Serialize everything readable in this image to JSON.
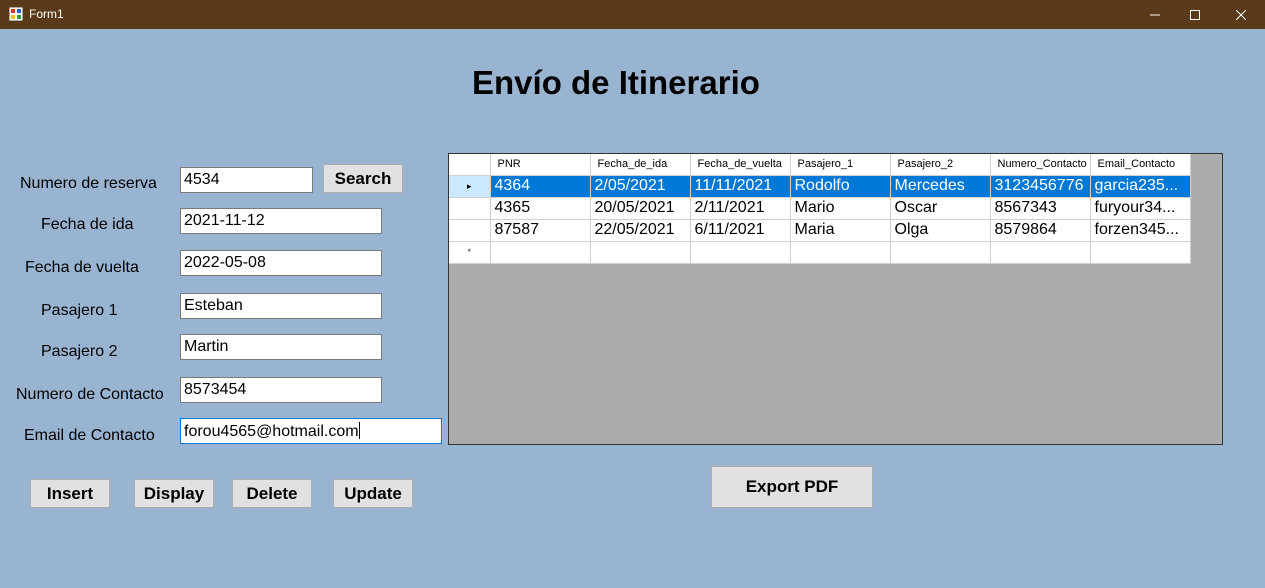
{
  "window": {
    "title": "Form1"
  },
  "heading": "Envío de Itinerario",
  "form": {
    "reserva_label": "Numero de reserva",
    "reserva_value": "4534",
    "fecha_ida_label": "Fecha de ida",
    "fecha_ida_value": "2021-11-12",
    "fecha_vuelta_label": "Fecha de vuelta",
    "fecha_vuelta_value": "2022-05-08",
    "pasajero1_label": "Pasajero 1",
    "pasajero1_value": "Esteban",
    "pasajero2_label": "Pasajero 2",
    "pasajero2_value": "Martin",
    "contacto_label": "Numero de Contacto",
    "contacto_value": "8573454",
    "email_label": "Email de Contacto",
    "email_value": "forou4565@hotmail.com"
  },
  "buttons": {
    "search": "Search",
    "insert": "Insert",
    "display": "Display",
    "delete": "Delete",
    "update": "Update",
    "export_pdf": "Export PDF"
  },
  "grid": {
    "columns": [
      "PNR",
      "Fecha_de_ida",
      "Fecha_de_vuelta",
      "Pasajero_1",
      "Pasajero_2",
      "Numero_Contacto",
      "Email_Contacto"
    ],
    "rows": [
      [
        "4364",
        "2/05/2021",
        "11/11/2021",
        "Rodolfo",
        "Mercedes",
        "3123456776",
        "garcia235..."
      ],
      [
        "4365",
        "20/05/2021",
        "2/11/2021",
        "Mario",
        "Oscar",
        "8567343",
        "furyour34..."
      ],
      [
        "87587",
        "22/05/2021",
        "6/11/2021",
        "Maria",
        "Olga",
        "8579864",
        "forzen345..."
      ]
    ],
    "selected_row": 0,
    "current_row_glyph": "▸",
    "new_row_glyph": "*"
  },
  "colors": {
    "form_background": "#99b4d1",
    "titlebar": "#5a3a18",
    "selection": "#0078d7",
    "grid_background": "#ababab"
  },
  "icons": {
    "app": "form-app-icon",
    "minimize": "minimize-icon",
    "maximize": "maximize-icon",
    "close": "close-icon"
  }
}
